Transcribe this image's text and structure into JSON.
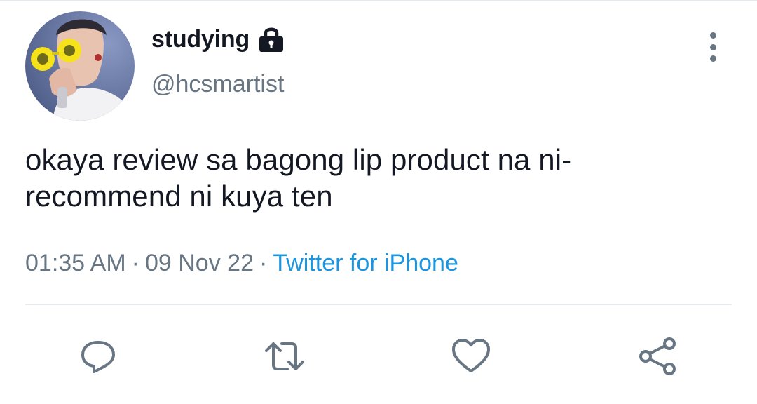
{
  "user": {
    "display_name": "studying",
    "handle": "@hcsmartist",
    "avatar_icon": "avatar-photo",
    "protected_icon": "lock-icon"
  },
  "tweet": {
    "text": "okaya review sa bagong lip product na ni-recommend ni kuya ten",
    "time": "01:35 AM",
    "date": "09 Nov 22",
    "separator": "·",
    "source": "Twitter for iPhone"
  },
  "actions": [
    {
      "name": "reply-button",
      "icon": "comment-icon"
    },
    {
      "name": "retweet-button",
      "icon": "retweet-icon"
    },
    {
      "name": "like-button",
      "icon": "heart-icon"
    },
    {
      "name": "share-button",
      "icon": "share-icon"
    }
  ],
  "colors": {
    "text": "#141823",
    "secondary": "#687684",
    "link": "#1b95e0",
    "divider": "#e6e9ec"
  }
}
